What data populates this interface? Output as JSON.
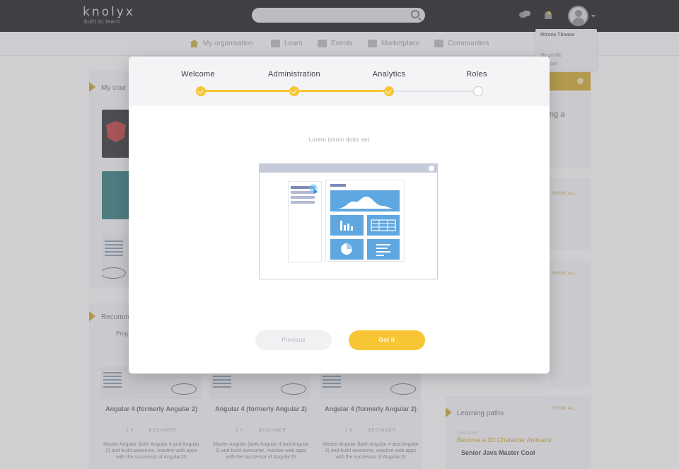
{
  "app": {
    "logo": "knolyx",
    "tagline": "built to learn"
  },
  "nav": {
    "items": [
      "My organisation",
      "Learn",
      "Events",
      "Marketplace",
      "Communities"
    ]
  },
  "profile_menu": {
    "name": "Mircea Tănase",
    "links": [
      "My profile",
      "Log out"
    ]
  },
  "background": {
    "my_courses_title": "My cour",
    "recommended_title": "Recomm",
    "prog_label": "Prog",
    "courses": [
      {
        "title": "Angular 4 (formerly Angular 2)",
        "hours": "2 h",
        "level": "BEGINNER",
        "desc": "Master Angular (both Angular 4 and Angular 2) and build awesome, reactive web apps with the successor of AngularJS"
      },
      {
        "title": "Angular 4 (formerly Angular 2)",
        "hours": "2 h",
        "level": "BEGINNER",
        "desc": "Master Angular (both Angular 4 and Angular 2) and build awesome, reactive web apps with the successor of AngularJS"
      },
      {
        "title": "Angular 4 (formerly Angular 2)",
        "hours": "2 h",
        "level": "BEGINNER",
        "desc": "Master Angular (both Angular 4 and Angular 2) and build awesome, reactive web apps with the successor of AngularJS"
      }
    ],
    "side_fragment": "ng a",
    "show_all": "SHOW ALL",
    "learning_paths_title": "Learning paths",
    "path_label": "JAVA WEB",
    "path_title": "Become a 3D Character Animator",
    "path_sub": "Senior Java Master Cool"
  },
  "modal": {
    "steps": [
      {
        "label": "Welcome",
        "done": true
      },
      {
        "label": "Administration",
        "done": true
      },
      {
        "label": "Analytics",
        "done": true
      },
      {
        "label": "Roles",
        "done": false
      }
    ],
    "body_text": "Lorem ipsum dolor set",
    "prev_label": "Previous",
    "next_label": "Got it"
  },
  "colors": {
    "accent": "#f8c534",
    "illustration_tile": "#5fa7e0",
    "topbar": "#2b2b2e"
  }
}
